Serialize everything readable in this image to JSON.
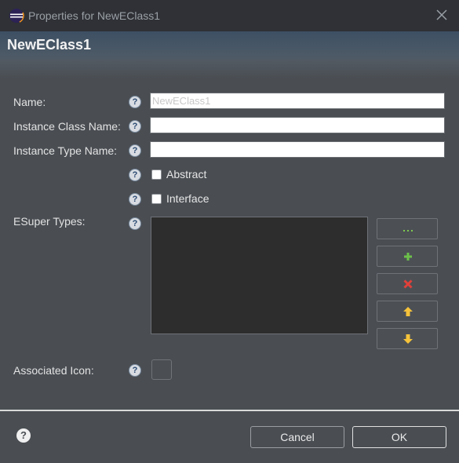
{
  "window": {
    "title": "Properties for NewEClass1",
    "close_icon": "close-icon"
  },
  "header": {
    "title": "NewEClass1"
  },
  "form": {
    "name": {
      "label": "Name:",
      "value": "NewEClass1"
    },
    "instance_class_name": {
      "label": "Instance Class Name:",
      "value": ""
    },
    "instance_type_name": {
      "label": "Instance Type Name:",
      "value": ""
    },
    "abstract": {
      "label": "Abstract",
      "checked": false
    },
    "interface": {
      "label": "Interface",
      "checked": false
    },
    "esuper_types": {
      "label": "ESuper Types:",
      "items": []
    },
    "associated_icon": {
      "label": "Associated Icon:"
    },
    "help_glyph": "?"
  },
  "side_buttons": [
    "browse-icon",
    "add-icon",
    "remove-icon",
    "move-up-icon",
    "move-down-icon"
  ],
  "footer": {
    "help_glyph": "?",
    "cancel_label": "Cancel",
    "ok_label": "OK"
  },
  "colors": {
    "background": "#4a4e53",
    "titlebar": "#2f3136",
    "header": "#3d5064",
    "list_bg": "#2d2d2d"
  }
}
